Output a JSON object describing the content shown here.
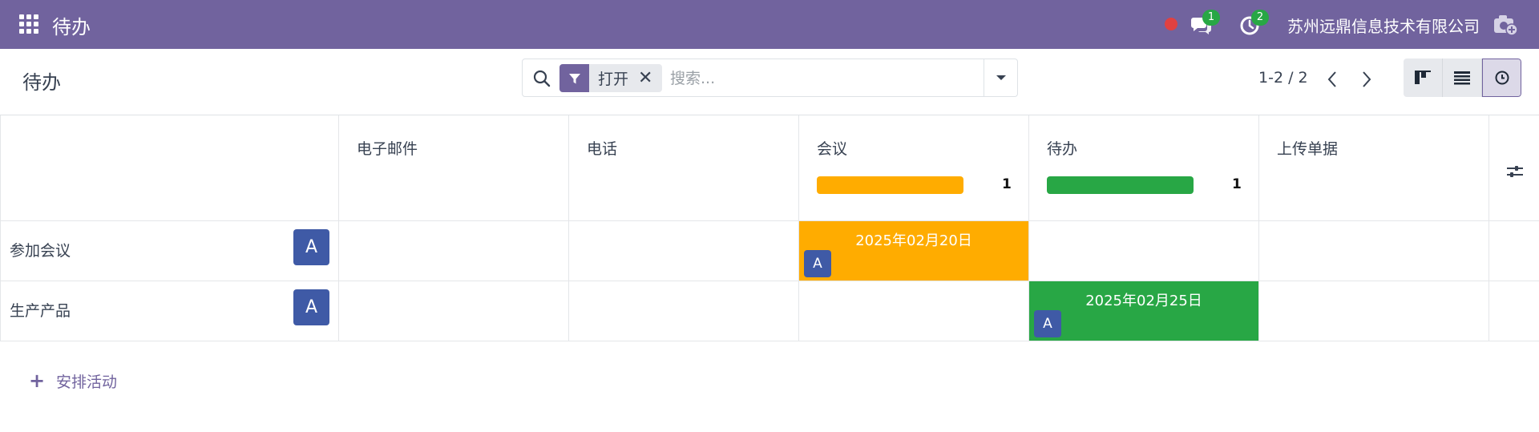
{
  "navbar": {
    "app_title": "待办",
    "messages_badge": "1",
    "activities_badge": "2",
    "company": "苏州远鼎信息技术有限公司"
  },
  "control_panel": {
    "title": "待办",
    "facet_label": "打开",
    "facet_close": "✕",
    "search_placeholder": "搜索...",
    "pager": "1-2 / 2"
  },
  "columns": [
    {
      "label": "电子邮件"
    },
    {
      "label": "电话"
    },
    {
      "label": "会议",
      "count": "1",
      "color": "#ffac00"
    },
    {
      "label": "待办",
      "count": "1",
      "color": "#28a745"
    },
    {
      "label": "上传单据"
    }
  ],
  "rows": [
    {
      "label": "参加会议",
      "avatar": "A",
      "activity": {
        "date": "2025年02月20日",
        "avatar": "A",
        "color": "#ffac00"
      }
    },
    {
      "label": "生产产品",
      "avatar": "A",
      "activity": {
        "date": "2025年02月25日",
        "avatar": "A",
        "color": "#28a745"
      }
    }
  ],
  "footer": {
    "schedule_icon": "+",
    "schedule_label": "安排活动"
  },
  "colors": {
    "brand": "#71639e",
    "avatar": "#3f5aa6"
  }
}
